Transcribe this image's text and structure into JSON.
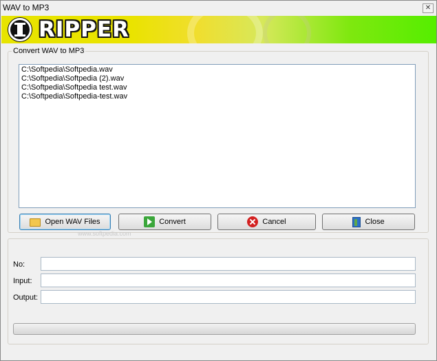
{
  "window": {
    "title": "WAV to MP3",
    "close_glyph": "✕"
  },
  "banner": {
    "logo_text": "RIPPER"
  },
  "convert_group": {
    "label": "Convert WAV to MP3",
    "files": [
      "C:\\Softpedia\\Softpedia.wav",
      "C:\\Softpedia\\Softpedia (2).wav",
      "C:\\Softpedia\\Softpedia test.wav",
      "C:\\Softpedia\\Softpedia-test.wav"
    ]
  },
  "buttons": {
    "open": "Open WAV Files",
    "convert": "Convert",
    "cancel": "Cancel",
    "close": "Close"
  },
  "watermark": "www.softpedia.com",
  "status": {
    "no_label": "No:",
    "no_value": "",
    "input_label": "Input:",
    "input_value": "",
    "output_label": "Output:",
    "output_value": "",
    "progress": 0
  },
  "icons": {
    "open": "folder-open-icon",
    "convert": "arrow-right-icon",
    "cancel": "cancel-x-icon",
    "close": "exit-door-icon"
  }
}
